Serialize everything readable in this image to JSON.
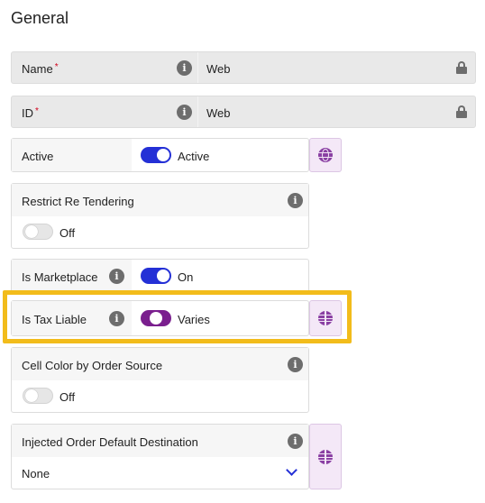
{
  "section": {
    "title": "General"
  },
  "name_field": {
    "label": "Name",
    "required_mark": "*",
    "value": "Web",
    "info_glyph": "i"
  },
  "id_field": {
    "label": "ID",
    "required_mark": "*",
    "value": "Web",
    "info_glyph": "i"
  },
  "active_field": {
    "label": "Active",
    "toggle_state": "on",
    "state_text": "Active"
  },
  "restrict_field": {
    "label": "Restrict Re Tendering",
    "toggle_state": "off",
    "state_text": "Off",
    "info_glyph": "i"
  },
  "marketplace_field": {
    "label": "Is Marketplace",
    "toggle_state": "on",
    "state_text": "On",
    "info_glyph": "i"
  },
  "tax_field": {
    "label": "Is Tax Liable",
    "toggle_state": "varies",
    "state_text": "Varies",
    "info_glyph": "i",
    "highlighted": true
  },
  "cell_color_field": {
    "label": "Cell Color by Order Source",
    "toggle_state": "off",
    "state_text": "Off",
    "info_glyph": "i"
  },
  "injected_field": {
    "label": "Injected Order Default Destination",
    "selected_value": "None",
    "info_glyph": "i"
  },
  "colors": {
    "toggle_on": "#2430d6",
    "toggle_varies": "#7a1f8e",
    "highlight": "#f2bc1b",
    "side_button_bg": "#f4e8f7",
    "required": "#d0021b"
  },
  "icons": {
    "info": "info-icon",
    "lock": "lock-icon",
    "store_settings": "store-settings-icon",
    "globe": "globe-icon",
    "dropdown": "chevron-down-icon"
  }
}
